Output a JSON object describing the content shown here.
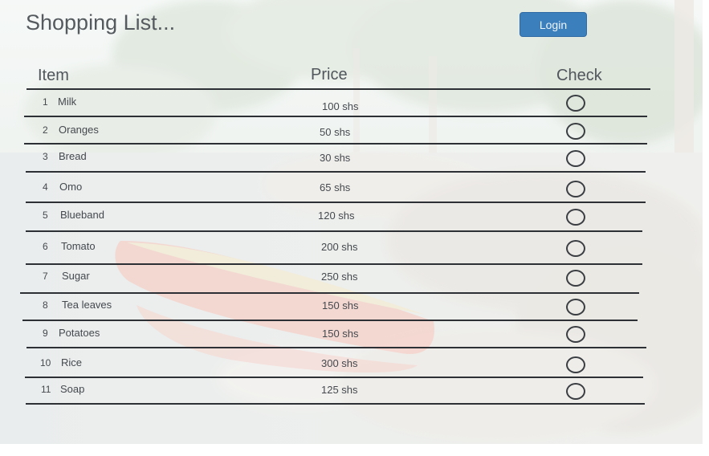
{
  "page": {
    "title": "Shopping List...",
    "login_label": "Login"
  },
  "table": {
    "headers": {
      "item": "Item",
      "price": "Price",
      "check": "Check"
    },
    "rows": [
      {
        "num": "1",
        "item": "Milk",
        "price": "100 shs"
      },
      {
        "num": "2",
        "item": "Oranges",
        "price": "50 shs"
      },
      {
        "num": "3",
        "item": "Bread",
        "price": "30 shs"
      },
      {
        "num": "4",
        "item": "Omo",
        "price": "65 shs"
      },
      {
        "num": "5",
        "item": "Blueband",
        "price": "120 shs"
      },
      {
        "num": "6",
        "item": "Tomato",
        "price": "200 shs"
      },
      {
        "num": "7",
        "item": "Sugar",
        "price": "250 shs"
      },
      {
        "num": "8",
        "item": "Tea leaves",
        "price": "150 shs"
      },
      {
        "num": "9",
        "item": "Potatoes",
        "price": "150 shs"
      },
      {
        "num": "10",
        "item": "Rice",
        "price": "300 shs"
      },
      {
        "num": "11",
        "item": "Soap",
        "price": "125 shs"
      }
    ]
  },
  "colors": {
    "login_button": "#3c7fbd",
    "row_line": "#2d3034",
    "text": "#45494e"
  }
}
